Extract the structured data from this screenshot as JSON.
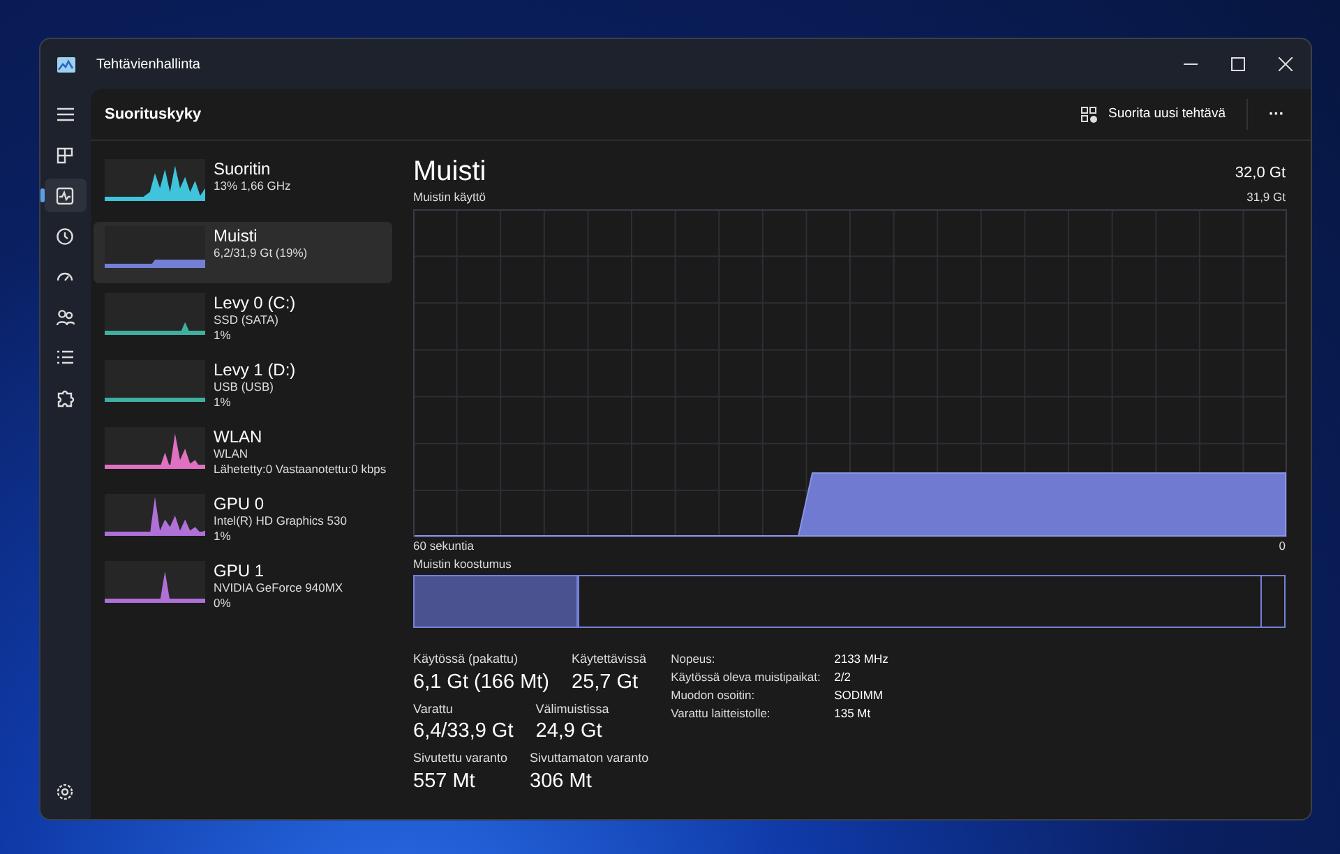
{
  "window": {
    "title": "Tehtävienhallinta"
  },
  "nav": [
    {
      "kind": "menu",
      "selected": false
    },
    {
      "kind": "processes",
      "selected": false
    },
    {
      "kind": "performance",
      "selected": true
    },
    {
      "kind": "history",
      "selected": false
    },
    {
      "kind": "startup",
      "selected": false
    },
    {
      "kind": "users",
      "selected": false
    },
    {
      "kind": "details",
      "selected": false
    },
    {
      "kind": "services",
      "selected": false
    },
    {
      "kind": "settings",
      "selected": false
    }
  ],
  "header": {
    "title": "Suorituskyky",
    "run_task": "Suorita uusi tehtävä",
    "more": "···"
  },
  "devices": [
    {
      "name": "Suoritin",
      "lines": [
        "13% 1,66 GHz"
      ],
      "color": "#3fc4dc",
      "selected": false
    },
    {
      "name": "Muisti",
      "lines": [
        "6,2/31,9 Gt (19%)"
      ],
      "color": "#7480d8",
      "selected": true
    },
    {
      "name": "Levy 0 (C:)",
      "lines": [
        "SSD (SATA)",
        "1%"
      ],
      "color": "#3fb0a0",
      "selected": false
    },
    {
      "name": "Levy 1 (D:)",
      "lines": [
        "USB (USB)",
        "1%"
      ],
      "color": "#3fb0a0",
      "selected": false
    },
    {
      "name": "WLAN",
      "lines": [
        "WLAN",
        "Lähetetty:0 Vastaanotettu:0 kbps"
      ],
      "color": "#e070c0",
      "selected": false
    },
    {
      "name": "GPU 0",
      "lines": [
        "Intel(R) HD Graphics 530",
        "1%"
      ],
      "color": "#b070d8",
      "selected": false
    },
    {
      "name": "GPU 1",
      "lines": [
        "NVIDIA GeForce 940MX",
        "0%"
      ],
      "color": "#b070d8",
      "selected": false
    }
  ],
  "detail": {
    "title": "Muisti",
    "total": "32,0 Gt",
    "usage_label": "Muistin käyttö",
    "usage_max": "31,9 Gt",
    "x_start": "60 sekuntia",
    "x_end": "0",
    "composition_label": "Muistin koostumus",
    "composition_in_use": {
      "level": 0.19
    },
    "stats": [
      [
        {
          "label": "Käytössä (pakattu)",
          "value": "6,1 Gt (166 Mt)"
        },
        {
          "label": "Käytettävissä",
          "value": "25,7 Gt"
        }
      ],
      [
        {
          "label": "Varattu",
          "value": "6,4/33,9 Gt"
        },
        {
          "label": "Välimuistissa",
          "value": "24,9 Gt"
        }
      ],
      [
        {
          "label": "Sivutettu varanto",
          "value": "557 Mt"
        },
        {
          "label": "Sivuttamaton varanto",
          "value": "306 Mt"
        }
      ]
    ],
    "properties": [
      {
        "key": "Nopeus:",
        "value": "2133 MHz"
      },
      {
        "key": "Käytössä oleva muistipaikat:",
        "value": "2/2"
      },
      {
        "key": "Muodon osoitin:",
        "value": "SODIMM"
      },
      {
        "key": "Varattu laitteistolle:",
        "value": "135 Mt"
      }
    ]
  }
}
